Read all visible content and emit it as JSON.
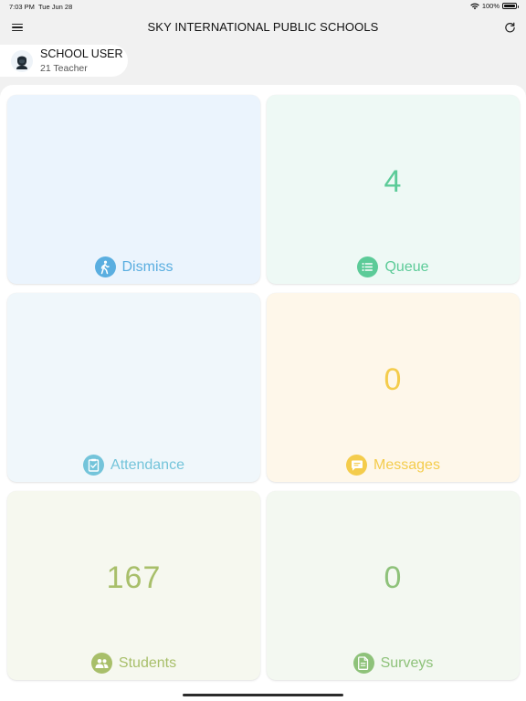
{
  "status_bar": {
    "time": "7:03 PM",
    "date": "Tue Jun 28",
    "battery": "100%"
  },
  "nav": {
    "title": "SKY INTERNATIONAL PUBLIC SCHOOLS"
  },
  "user": {
    "name": "SCHOOL USER",
    "role": "21 Teacher"
  },
  "tiles": [
    {
      "label": "Dismiss",
      "count": "",
      "icon": "walking-person-icon",
      "color": "#5aaee0",
      "bg": "#ebf4fd"
    },
    {
      "label": "Queue",
      "count": "4",
      "icon": "list-icon",
      "color": "#5ccb98",
      "bg": "#eef9f5"
    },
    {
      "label": "Attendance",
      "count": "",
      "icon": "clipboard-check-icon",
      "color": "#74c4da",
      "bg": "#f0f7fb"
    },
    {
      "label": "Messages",
      "count": "0",
      "icon": "chat-bubble-icon",
      "color": "#f4cc4c",
      "bg": "#fef7ea"
    },
    {
      "label": "Students",
      "count": "167",
      "icon": "people-icon",
      "color": "#a8bf6a",
      "bg": "#f6f8ef"
    },
    {
      "label": "Surveys",
      "count": "0",
      "icon": "document-icon",
      "color": "#8ec27a",
      "bg": "#f3f8f1"
    }
  ]
}
